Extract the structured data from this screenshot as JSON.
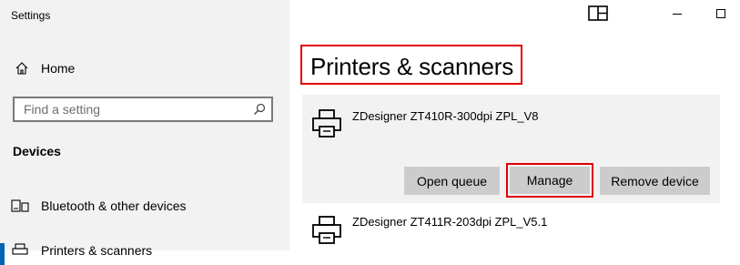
{
  "window": {
    "title": "Settings"
  },
  "sidebar": {
    "home_label": "Home",
    "search_placeholder": "Find a setting",
    "section_heading": "Devices",
    "items": [
      {
        "label": "Bluetooth & other devices",
        "icon": "bluetooth-devices-icon"
      },
      {
        "label": "Printers & scanners",
        "icon": "printer-icon",
        "selected": true
      }
    ]
  },
  "main": {
    "page_title": "Printers & scanners",
    "printers": [
      {
        "name": "ZDesigner ZT410R-300dpi ZPL_V8",
        "expanded": true,
        "actions": {
          "open_queue": "Open queue",
          "manage": "Manage",
          "remove": "Remove device"
        }
      },
      {
        "name": "ZDesigner ZT411R-203dpi ZPL_V5.1",
        "expanded": false
      }
    ]
  },
  "colors": {
    "highlight": "#e00000",
    "accent": "#0063b1",
    "sidebar_bg": "#f2f2f2",
    "button_bg": "#cccccc"
  }
}
